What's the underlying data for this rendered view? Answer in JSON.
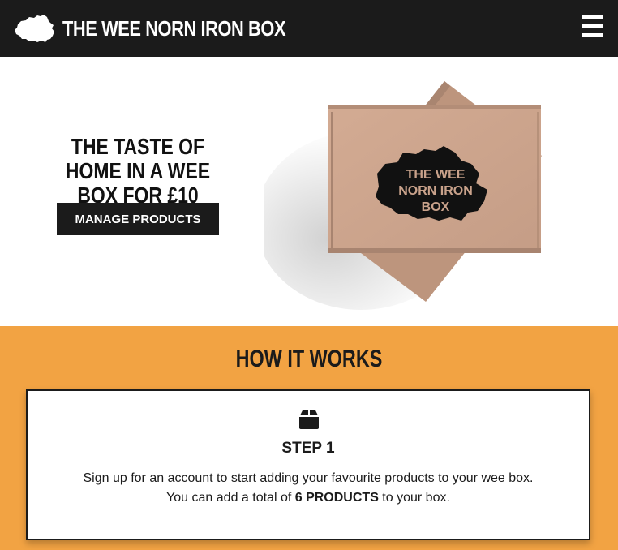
{
  "navbar": {
    "brand_name": "THE WEE NORN IRON BOX",
    "logo_icon": "northern-ireland-map-icon",
    "menu_icon": "hamburger-menu-icon"
  },
  "hero": {
    "title": "THE TASTE OF HOME IN A WEE BOX FOR £10",
    "button_label": "MANAGE PRODUCTS",
    "box_logo_lines": [
      "THE WEE",
      "NORN IRON",
      "BOX"
    ]
  },
  "how_it_works": {
    "title": "HOW IT WORKS",
    "steps": [
      {
        "icon": "box-icon",
        "title": "STEP 1",
        "line1": "Sign up for an account to start adding your favourite products to your wee box.",
        "line2_before": "You can add a total of ",
        "line2_bold": "6 PRODUCTS",
        "line2_after": " to your box."
      }
    ]
  },
  "colors": {
    "navbar_bg": "#1b1b1b",
    "accent_orange": "#f2a343",
    "box_cardboard": "#c9a28b",
    "text_dark": "#1b1b1b"
  }
}
